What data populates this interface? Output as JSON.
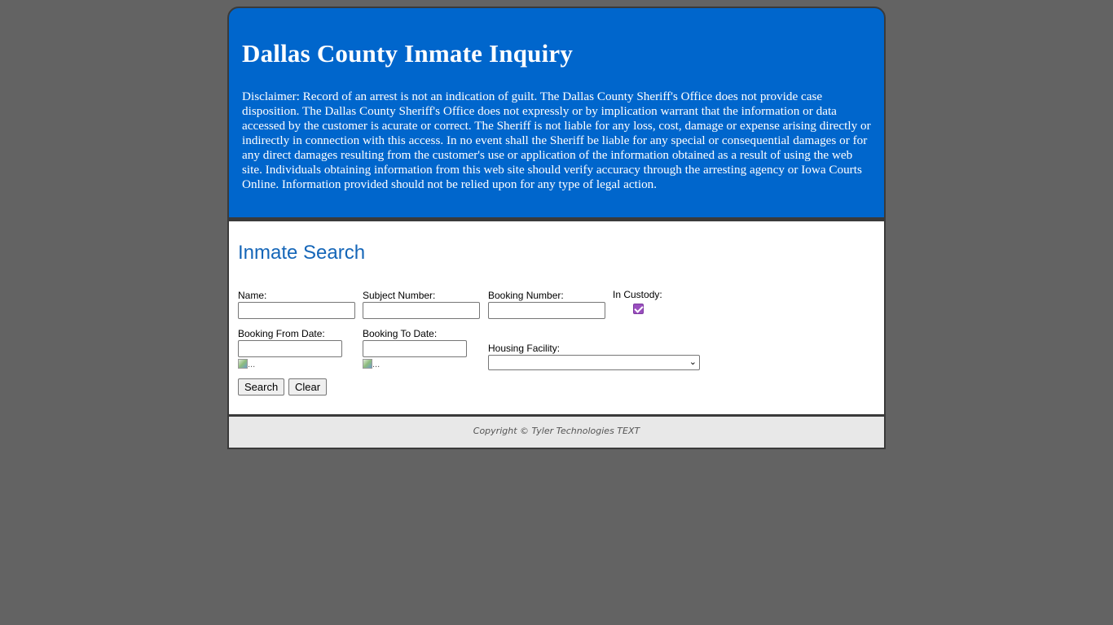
{
  "header": {
    "title": "Dallas County Inmate Inquiry",
    "disclaimer": "Disclaimer: Record of an arrest is not an indication of guilt. The Dallas County Sheriff's Office does not provide case disposition. The Dallas County Sheriff's Office does not expressly or by implication warrant that the information or data accessed by the customer is acurate or correct. The Sheriff is not liable for any loss, cost, damage or expense arising directly or indirectly in connection with this access. In no event shall the Sheriff be liable for any special or consequential damages or for any direct damages resulting from the customer's use or application of the information obtained as a result of using the web site. Individuals obtaining information from this web site should verify accuracy through the arresting agency or Iowa Courts Online. Information provided should not be relied upon for any type of legal action."
  },
  "search": {
    "title": "Inmate Search",
    "name_label": "Name:",
    "name_value": "",
    "subject_label": "Subject Number:",
    "subject_value": "",
    "booking_label": "Booking Number:",
    "booking_value": "",
    "custody_label": "In Custody:",
    "custody_checked": true,
    "from_label": "Booking From Date:",
    "from_value": "",
    "to_label": "Booking To Date:",
    "to_value": "",
    "calendar_alt": "...",
    "housing_label": "Housing Facility:",
    "housing_selected": "",
    "search_button": "Search",
    "clear_button": "Clear"
  },
  "footer": {
    "copyright": "Copyright © Tyler Technologies TEXT"
  },
  "colors": {
    "header_bg": "#0066cc",
    "page_bg": "#636363",
    "title_blue": "#1566b8",
    "checkbox_accent": "#9a4fbf"
  }
}
